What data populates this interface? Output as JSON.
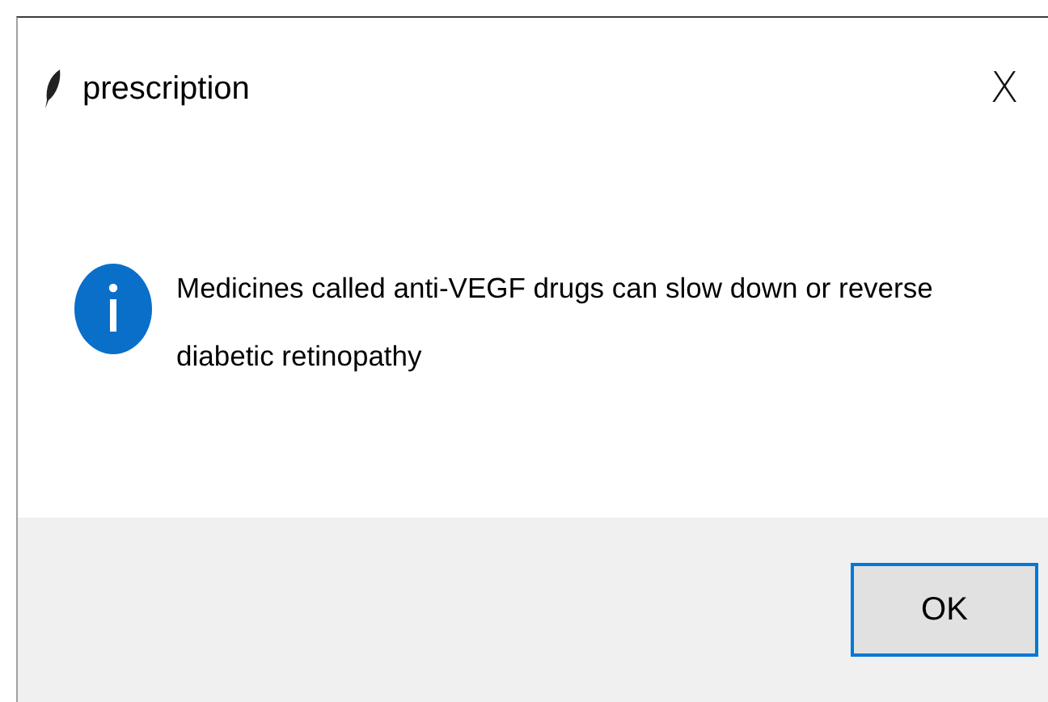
{
  "window": {
    "title": "prescription",
    "close": "X"
  },
  "message": {
    "kind": "info",
    "text": "Medicines called anti-VEGF drugs can slow down or reverse diabetic retinopathy"
  },
  "buttons": [
    {
      "label": "OK",
      "selected": true
    }
  ]
}
